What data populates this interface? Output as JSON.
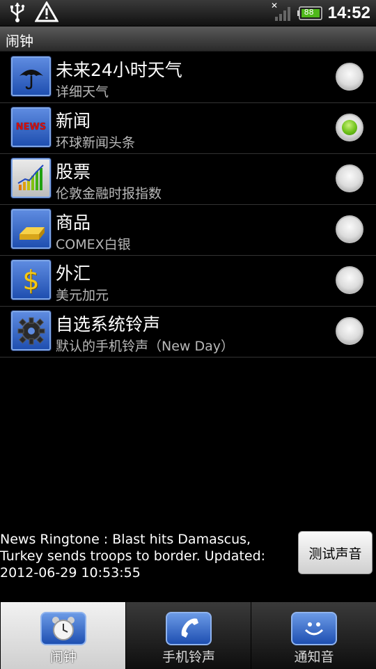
{
  "status_bar": {
    "time": "14:52",
    "battery": "88"
  },
  "title_bar": {
    "title": "闹钟"
  },
  "list": [
    {
      "icon": "umbrella-icon",
      "title": "未来24小时天气",
      "subtitle": "详细天气",
      "selected": false
    },
    {
      "icon": "news-icon",
      "icon_text": "NEWS",
      "title": "新闻",
      "subtitle": "环球新闻头条",
      "selected": true
    },
    {
      "icon": "chart-icon",
      "title": "股票",
      "subtitle": "伦敦金融时报指数",
      "selected": false
    },
    {
      "icon": "gold-bar-icon",
      "title": "商品",
      "subtitle": "COMEX白银",
      "selected": false
    },
    {
      "icon": "dollar-icon",
      "icon_text": "$",
      "title": "外汇",
      "subtitle": "美元加元",
      "selected": false
    },
    {
      "icon": "gear-icon",
      "title": "自选系统铃声",
      "subtitle": "默认的手机铃声（New Day）",
      "selected": false
    }
  ],
  "news_info": {
    "text": "News Ringtone : Blast hits Damascus, Turkey sends troops to border. Updated: 2012-06-29 10:53:55"
  },
  "test_button": {
    "label": "测试声音"
  },
  "tabs": [
    {
      "label": "闹钟",
      "icon": "alarm-clock-icon",
      "active": true
    },
    {
      "label": "手机铃声",
      "icon": "phone-icon",
      "active": false
    },
    {
      "label": "通知音",
      "icon": "smiley-icon",
      "active": false
    }
  ]
}
